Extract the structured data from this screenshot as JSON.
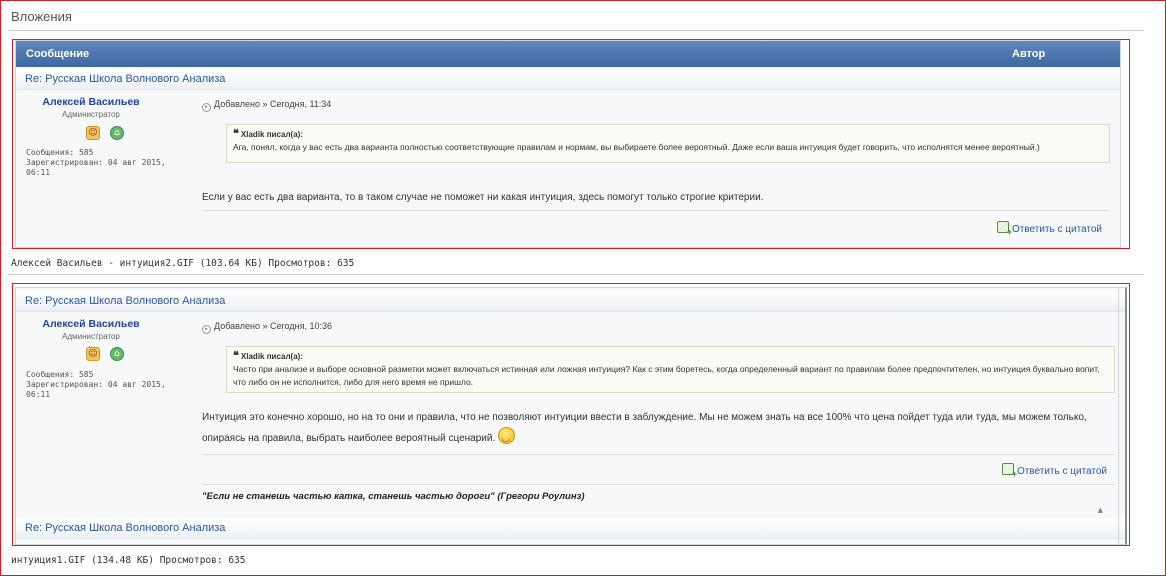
{
  "section": {
    "title": "Вложения"
  },
  "attachments": [
    {
      "caption": "Алексей Васильев - интуиция2.GIF (103.64 КБ) Просмотров: 635",
      "table_header": {
        "message": "Сообщение",
        "author": "Автор"
      },
      "post": {
        "title": "Re: Русская Школа Волнового Анализа",
        "author_name": "Алексей Васильев",
        "author_role": "Администратор",
        "messages_label": "Сообщения: 585",
        "registered_label": "Зарегистрирован: 04 авг 2015, 06:11",
        "added": "Добавлено » Сегодня, 11:34",
        "quote_author": "Xladik писал(а):",
        "quote_text": "Ага, понял, когда у вас есть два варианта полностью соответствующие правилам и нормам, вы выбираете более вероятный. Даже если ваша интуиция будет говорить, что исполнятся менее вероятный.)",
        "text": "Если у вас есть два варианта, то в таком случае не поможет ни какая интуиция, здесь помогут только строгие критерии.",
        "reply_label": "Ответить с цитатой"
      }
    },
    {
      "caption": "интуиция1.GIF (134.48 КБ) Просмотров: 635",
      "post": {
        "title": "Re: Русская Школа Волнового Анализа",
        "author_name": "Алексей Васильев",
        "author_role": "Администратор",
        "messages_label": "Сообщения: 585",
        "registered_label": "Зарегистрирован: 04 авг 2015, 06:11",
        "added": "Добавлено » Сегодня, 10:36",
        "quote_author": "Xladik писал(а):",
        "quote_text": "Часто при анализе и выборе основной разметки может включаться истинная или ложная интуиция? Как с этим боретесь, когда определенный вариант по правилам более предпочтителен, но интуиция буквально вопит, что либо он не исполнится, либо для него время не пришло.",
        "text": "Интуиция это конечно хорошо, но на то они и правила, что не позволяют интуиции ввести в заблуждение. Мы не можем знать на все 100% что цена пойдет туда или туда, мы можем только, опираясь на правила, выбрать наиболее вероятный сценарий.",
        "reply_label": "Ответить с цитатой",
        "signature": "\"Если не станешь частью катка, станешь частью дороги\" (Грегори Роулинз)"
      },
      "next_post_title": "Re: Русская Школа Волнового Анализа"
    }
  ]
}
